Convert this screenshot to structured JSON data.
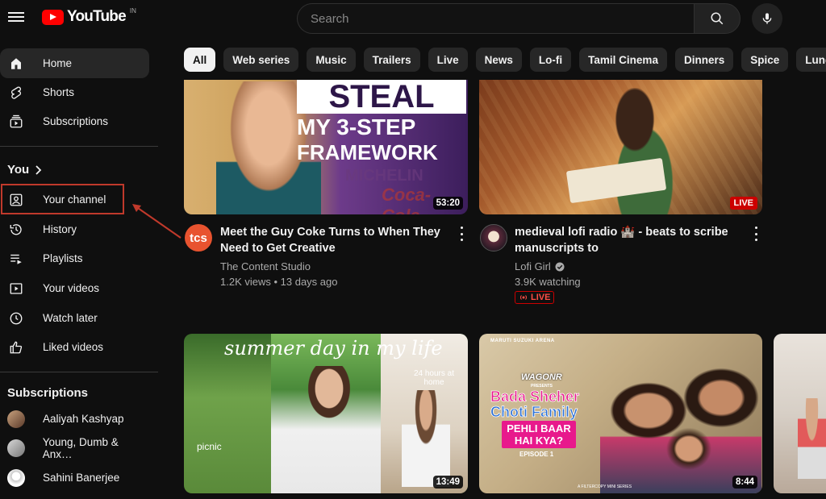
{
  "header": {
    "logo_text": "YouTube",
    "country_code": "IN",
    "search_placeholder": "Search"
  },
  "sidebar": {
    "main": [
      {
        "label": "Home",
        "icon": "home-icon"
      },
      {
        "label": "Shorts",
        "icon": "shorts-icon"
      },
      {
        "label": "Subscriptions",
        "icon": "subscriptions-icon"
      }
    ],
    "you_title": "You",
    "you_items": [
      {
        "label": "Your channel",
        "icon": "your-channel-icon"
      },
      {
        "label": "History",
        "icon": "history-icon"
      },
      {
        "label": "Playlists",
        "icon": "playlists-icon"
      },
      {
        "label": "Your videos",
        "icon": "your-videos-icon"
      },
      {
        "label": "Watch later",
        "icon": "watch-later-icon"
      },
      {
        "label": "Liked videos",
        "icon": "liked-videos-icon"
      }
    ],
    "subscriptions_title": "Subscriptions",
    "subscriptions": [
      {
        "label": "Aaliyah Kashyap"
      },
      {
        "label": "Young, Dumb & Anx…"
      },
      {
        "label": "Sahini Banerjee"
      }
    ]
  },
  "chips": [
    "All",
    "Web series",
    "Music",
    "Trailers",
    "Live",
    "News",
    "Lo-fi",
    "Tamil Cinema",
    "Dinners",
    "Spice",
    "Lunges"
  ],
  "videos": [
    {
      "title_line1": "Meet the Guy Coke Turns to When They",
      "title_line2": "Need to Get Creative",
      "channel": "The Content Studio",
      "meta": "1.2K views • 13 days ago",
      "duration": "53:20",
      "avatar_text": "tcs",
      "thumb_line1": "STEAL",
      "thumb_line2": "MY 3-STEP",
      "thumb_line3": "FRAMEWORK",
      "thumb_brand1": "MICHELIN",
      "thumb_brand2": "Coca-Cola"
    },
    {
      "title_line1": "medieval lofi radio 🏰 - beats to scribe",
      "title_line2": "manuscripts to",
      "channel": "Lofi Girl",
      "meta": "3.9K watching",
      "badge": "LIVE",
      "live_label": "LIVE"
    },
    {
      "duration": "13:49",
      "thumb_title": "summer day in my life",
      "thumb_note": "24 hours at home",
      "thumb_caption": "picnic"
    },
    {
      "duration": "8:44",
      "thumb_brand": "MARUTI SUZUKI ARENA",
      "thumb_logo": "WAGONR",
      "thumb_presents": "PRESENTS",
      "thumb_title1": "Bada Sheher",
      "thumb_title2": "Choti Family",
      "thumb_q1": "PEHLI BAAR",
      "thumb_q2": "HAI KYA?",
      "thumb_episode": "EPISODE 1",
      "thumb_footer": "A FILTERCOPY MINI SERIES"
    }
  ],
  "colors": {
    "background": "#0f0f0f",
    "brand_red": "#ff0000",
    "highlight": "#c0392b",
    "chip_bg": "#272727"
  }
}
